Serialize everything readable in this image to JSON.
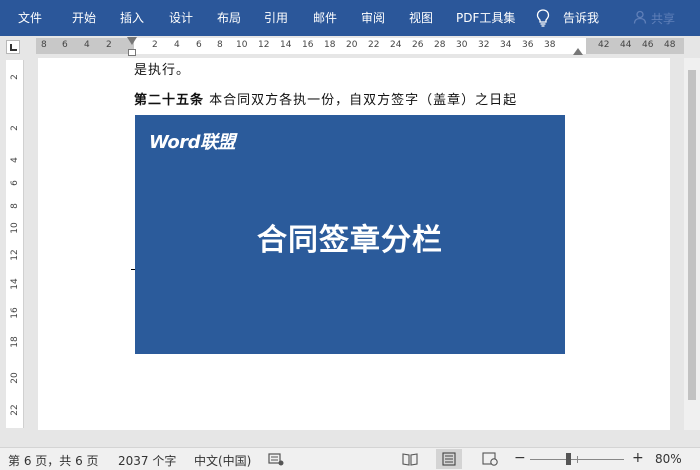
{
  "ribbon": {
    "tabs": [
      "文件",
      "开始",
      "插入",
      "设计",
      "布局",
      "引用",
      "邮件",
      "审阅",
      "视图",
      "PDF工具集"
    ],
    "tell_me": "告诉我",
    "share": "共享"
  },
  "ruler": {
    "numbers": [
      "8",
      "6",
      "4",
      "2",
      "2",
      "4",
      "6",
      "8",
      "10",
      "12",
      "14",
      "16",
      "18",
      "20",
      "22",
      "24",
      "26",
      "28",
      "30",
      "32",
      "34",
      "36",
      "38",
      "42",
      "44",
      "46",
      "48"
    ],
    "vertical_numbers": [
      "2",
      "2",
      "4",
      "6",
      "8",
      "10",
      "12",
      "14",
      "16",
      "18",
      "20",
      "22"
    ]
  },
  "document": {
    "line1": "是执行。",
    "line2_bold": "第二十五条",
    "line2_text": "本合同双方各执一份，自双方签字（盖章）之日起",
    "banner_logo": "Word联盟",
    "banner_title": "合同签章分栏"
  },
  "status": {
    "page_info": "第 6 页，共 6 页",
    "word_count": "2037 个字",
    "language": "中文(中国)",
    "zoom": "80%",
    "zoom_minus": "−",
    "zoom_plus": "+"
  },
  "colors": {
    "ribbon": "#2b579a",
    "banner": "#2b5b9b"
  }
}
